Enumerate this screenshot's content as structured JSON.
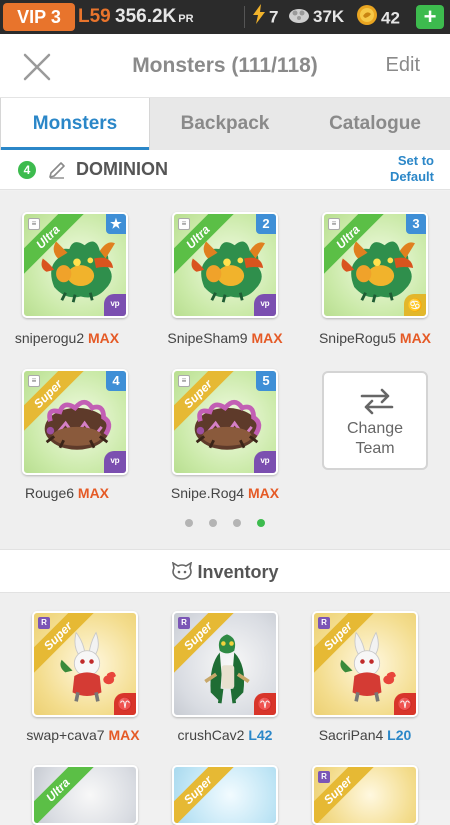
{
  "status": {
    "vip": "VIP 3",
    "level": "L59",
    "power": "356.2K",
    "power_suffix": "PR",
    "energy": "7",
    "food": "37K",
    "gold": "42",
    "add": "+"
  },
  "header": {
    "title": "Monsters (111/118)",
    "edit": "Edit"
  },
  "tabs": [
    "Monsters",
    "Backpack",
    "Catalogue"
  ],
  "active_tab": "Monsters",
  "team": {
    "number": "4",
    "name": "DOMINION",
    "set_default": [
      "Set to",
      "Default"
    ]
  },
  "team_monsters": [
    {
      "rarity": "Ultra",
      "slot": "★",
      "element": "ᵛᵖ",
      "name": "sniperogu2",
      "level": "MAX"
    },
    {
      "rarity": "Ultra",
      "slot": "2",
      "element": "ᵛᵖ",
      "name": "SnipeSham9",
      "level": "MAX"
    },
    {
      "rarity": "Ultra",
      "slot": "3",
      "element": "♋",
      "name": "SnipeRogu5",
      "level": "MAX"
    },
    {
      "rarity": "Super",
      "slot": "4",
      "element": "ᵛᵖ",
      "name": "Rouge6",
      "level": "MAX"
    },
    {
      "rarity": "Super",
      "slot": "5",
      "element": "ᵛᵖ",
      "name": "Snipe.Rog4",
      "level": "MAX"
    }
  ],
  "change_team": [
    "Change",
    "Team"
  ],
  "pager": {
    "count": 4,
    "active": 4
  },
  "inventory": {
    "title": "Inventory",
    "items": [
      {
        "rarity": "Super",
        "badge": "R",
        "element": "♈",
        "name": "swap+cava7",
        "level": "MAX"
      },
      {
        "rarity": "Super",
        "badge": "R",
        "element": "♈",
        "name": "crushCav2",
        "level": "L42"
      },
      {
        "rarity": "Super",
        "badge": "R",
        "element": "♈",
        "name": "SacriPan4",
        "level": "L20"
      },
      {
        "rarity": "Ultra"
      },
      {
        "rarity": "Super"
      },
      {
        "rarity": "Super"
      }
    ]
  },
  "colors": {
    "accent": "#2b87c8",
    "max": "#e55a26",
    "vip": "#e8742c",
    "green": "#3dbb4e"
  }
}
